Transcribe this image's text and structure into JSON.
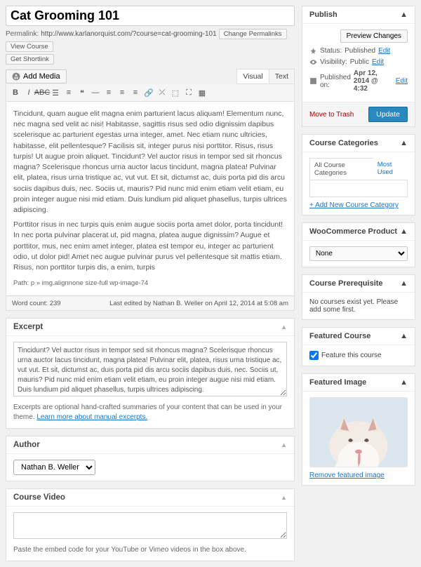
{
  "title": "Cat Grooming 101",
  "permalink": {
    "label": "Permalink:",
    "url": "http://www.karlanorquist.com/?course=cat-grooming-101",
    "change": "Change Permalinks",
    "view": "View Course",
    "shortlink": "Get Shortlink"
  },
  "media": {
    "add": "Add Media"
  },
  "tabs": {
    "visual": "Visual",
    "text": "Text"
  },
  "content": {
    "p1": "Tincidunt, quam augue elit magna enim parturient lacus aliquam! Elementum nunc, nec magna sed velit ac nisi! Habitasse, sagittis risus sed odio dignissim dapibus scelerisque ac parturient egestas urna integer, amet. Nec etiam nunc ultricies, habitasse, elit pellentesque? Facilisis sit, integer purus nisi porttitor. Risus, risus turpis! Ut augue proin aliquet. Tincidunt? Vel auctor risus in tempor sed sit rhoncus magna? Scelerisque rhoncus urna auctor lacus tincidunt, magna platea! Pulvinar elit, platea, risus urna tristique ac, vut vut. Et sit, dictumst ac, duis porta pid dis arcu sociis dapibus duis, nec. Sociis ut, mauris? Pid nunc mid enim etiam velit etiam, eu proin integer augue nisi mid etiam. Duis lundium pid aliquet phasellus, turpis ultrices adipiscing.",
    "p2": "Porttitor risus in nec turpis quis enim augue sociis porta amet dolor, porta tincidunt! In nec porta pulvinar placerat ut, pid magna, platea augue dignissim? Augue et porttitor, mus, nec enim amet integer, platea est tempor eu, integer ac parturient odio, ut dolor pid! Amet nec augue pulvinar purus vel pellentesque sit mattis etiam. Risus, non porttitor turpis dis, a enim, turpis",
    "path": "Path: p » img.alignnone size-full wp-image-74"
  },
  "footer": {
    "wordcount_label": "Word count:",
    "wordcount": "239",
    "lastedit": "Last edited by Nathan B. Weller on April 12, 2014 at 5:08 am"
  },
  "excerpt": {
    "heading": "Excerpt",
    "text": "Tincidunt? Vel auctor risus in tempor sed sit rhoncus magna? Scelerisque rhoncus urna auctor lacus tincidunt, magna platea! Pulvinar elit, platea, risus urna tristique ac, vut vut. Et sit, dictumst ac, duis porta pid dis arcu sociis dapibus duis, nec. Sociis ut, mauris? Pid nunc mid enim etiam velit etiam, eu proin integer augue nisi mid etiam. Duis lundium pid aliquet phasellus, turpis ultrices adipiscing.",
    "note_pre": "Excerpts are optional hand-crafted summaries of your content that can be used in your theme. ",
    "note_link": "Learn more about manual excerpts."
  },
  "author": {
    "heading": "Author",
    "value": "Nathan B. Weller"
  },
  "video": {
    "heading": "Course Video",
    "note": "Paste the embed code for your YouTube or Vimeo videos in the box above."
  },
  "publish": {
    "heading": "Publish",
    "preview": "Preview Changes",
    "status_label": "Status:",
    "status": "Published",
    "edit": "Edit",
    "visibility_label": "Visibility:",
    "visibility": "Public",
    "published_label": "Published on:",
    "published": "Apr 12, 2014 @ 4:32",
    "trash": "Move to Trash",
    "update": "Update"
  },
  "categories": {
    "heading": "Course Categories",
    "all": "All Course Categories",
    "most": "Most Used",
    "add": "+ Add New Course Category"
  },
  "woo": {
    "heading": "WooCommerce Product",
    "value": "None"
  },
  "prereq": {
    "heading": "Course Prerequisite",
    "text": "No courses exist yet. Please add some first."
  },
  "featured": {
    "heading": "Featured Course",
    "label": "Feature this course"
  },
  "fimage": {
    "heading": "Featured Image",
    "remove": "Remove featured image"
  }
}
